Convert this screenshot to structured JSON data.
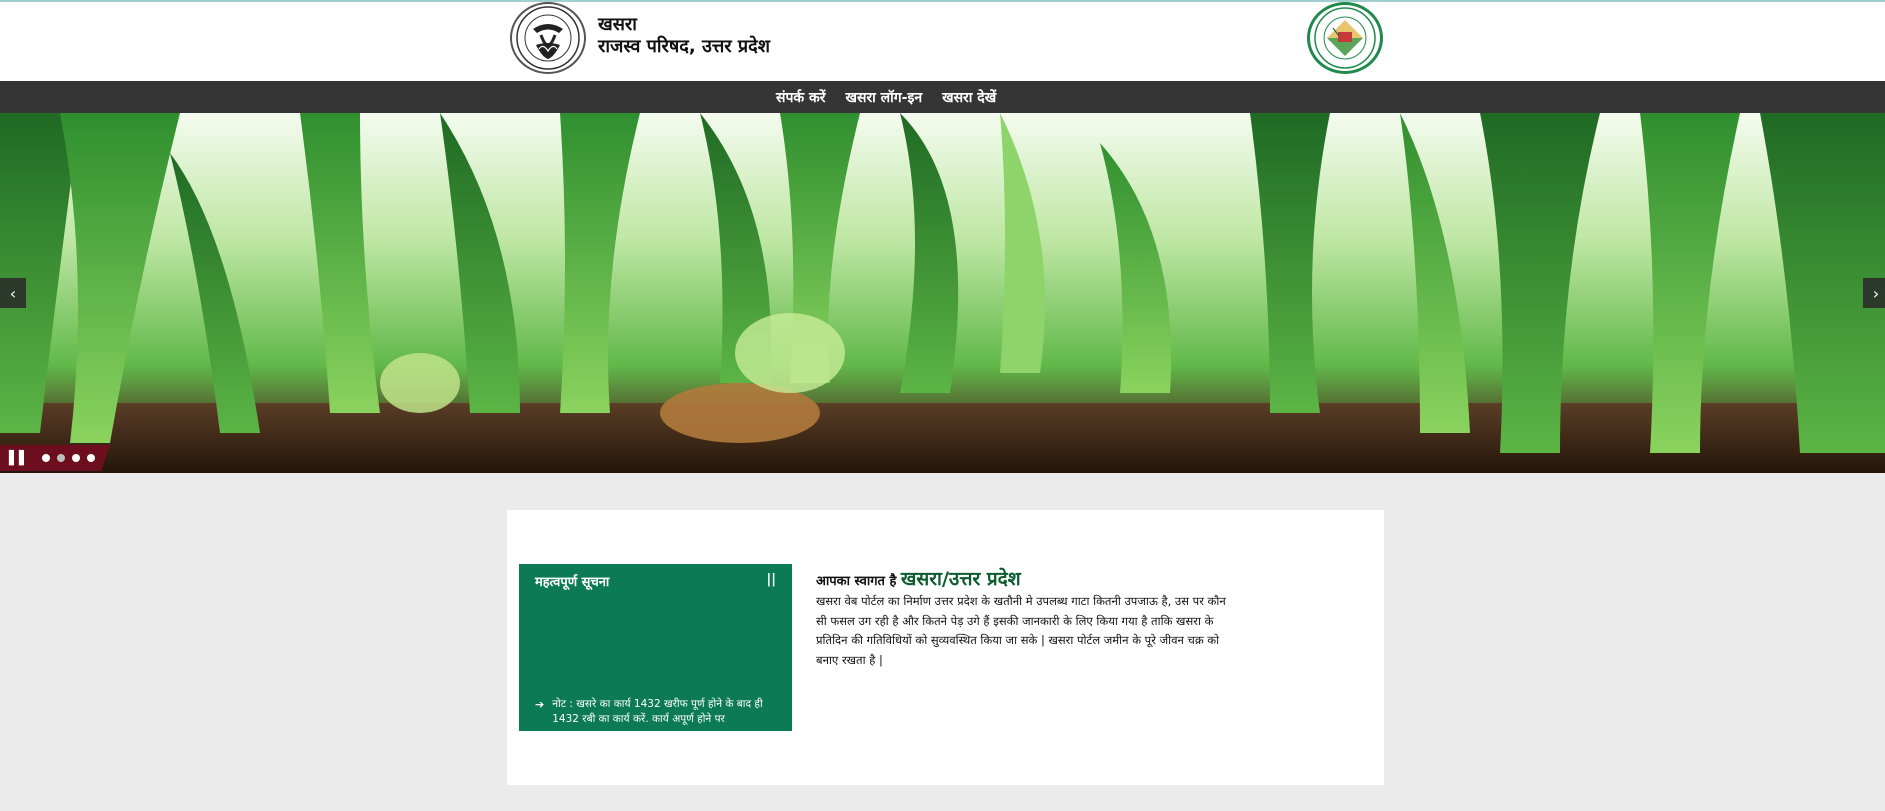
{
  "header": {
    "title_line1": "खसरा",
    "title_line2": "राजस्व परिषद, उत्तर प्रदेश",
    "left_logo_icon": "up-govt-emblem-icon",
    "right_logo_icon": "revenue-council-seal-icon"
  },
  "nav": {
    "items": [
      {
        "label": "संपर्क करें"
      },
      {
        "label": "खसरा लॉग-इन"
      },
      {
        "label": "खसरा देखें"
      }
    ]
  },
  "banner": {
    "prev_icon": "‹",
    "next_icon": "›",
    "pause_icon": "▌▌",
    "slide_count": 4,
    "active_slide": 2
  },
  "notice": {
    "title": "महत्वपूर्ण सूचना",
    "pause_label": "||",
    "item_text": "नोट : खसरे का कार्य 1432 खरीफ पूर्ण होने के बाद ही 1432 रबी का कार्य करें. कार्य अपूर्ण होने पर"
  },
  "welcome": {
    "lead": "आपका स्वागत है ",
    "highlight": "खसरा/उत्तर प्रदेश",
    "body": "खसरा वेब पोर्टल का निर्माण उत्तर प्रदेश के खतौनी मे उपलब्ध गाटा कितनी उपजाऊ है, उस पर कौन सी फसल उग रही है और कितने पेड़ उगे हैं इसकी जानकारी के लिए किया गया है ताकि खसरा के प्रतिदिन की गतिविधियों को सुव्यवस्थित किया जा सके | खसरा पोर्टल जमीन के पूरे जीवन चक्र को बनाए रखता है |"
  },
  "colors": {
    "navbar": "#353535",
    "notice_bg": "#0b7a55",
    "slider_controls": "#6d0e1f",
    "welcome_highlight": "#0c5c2f",
    "page_bg": "#ebebeb"
  }
}
